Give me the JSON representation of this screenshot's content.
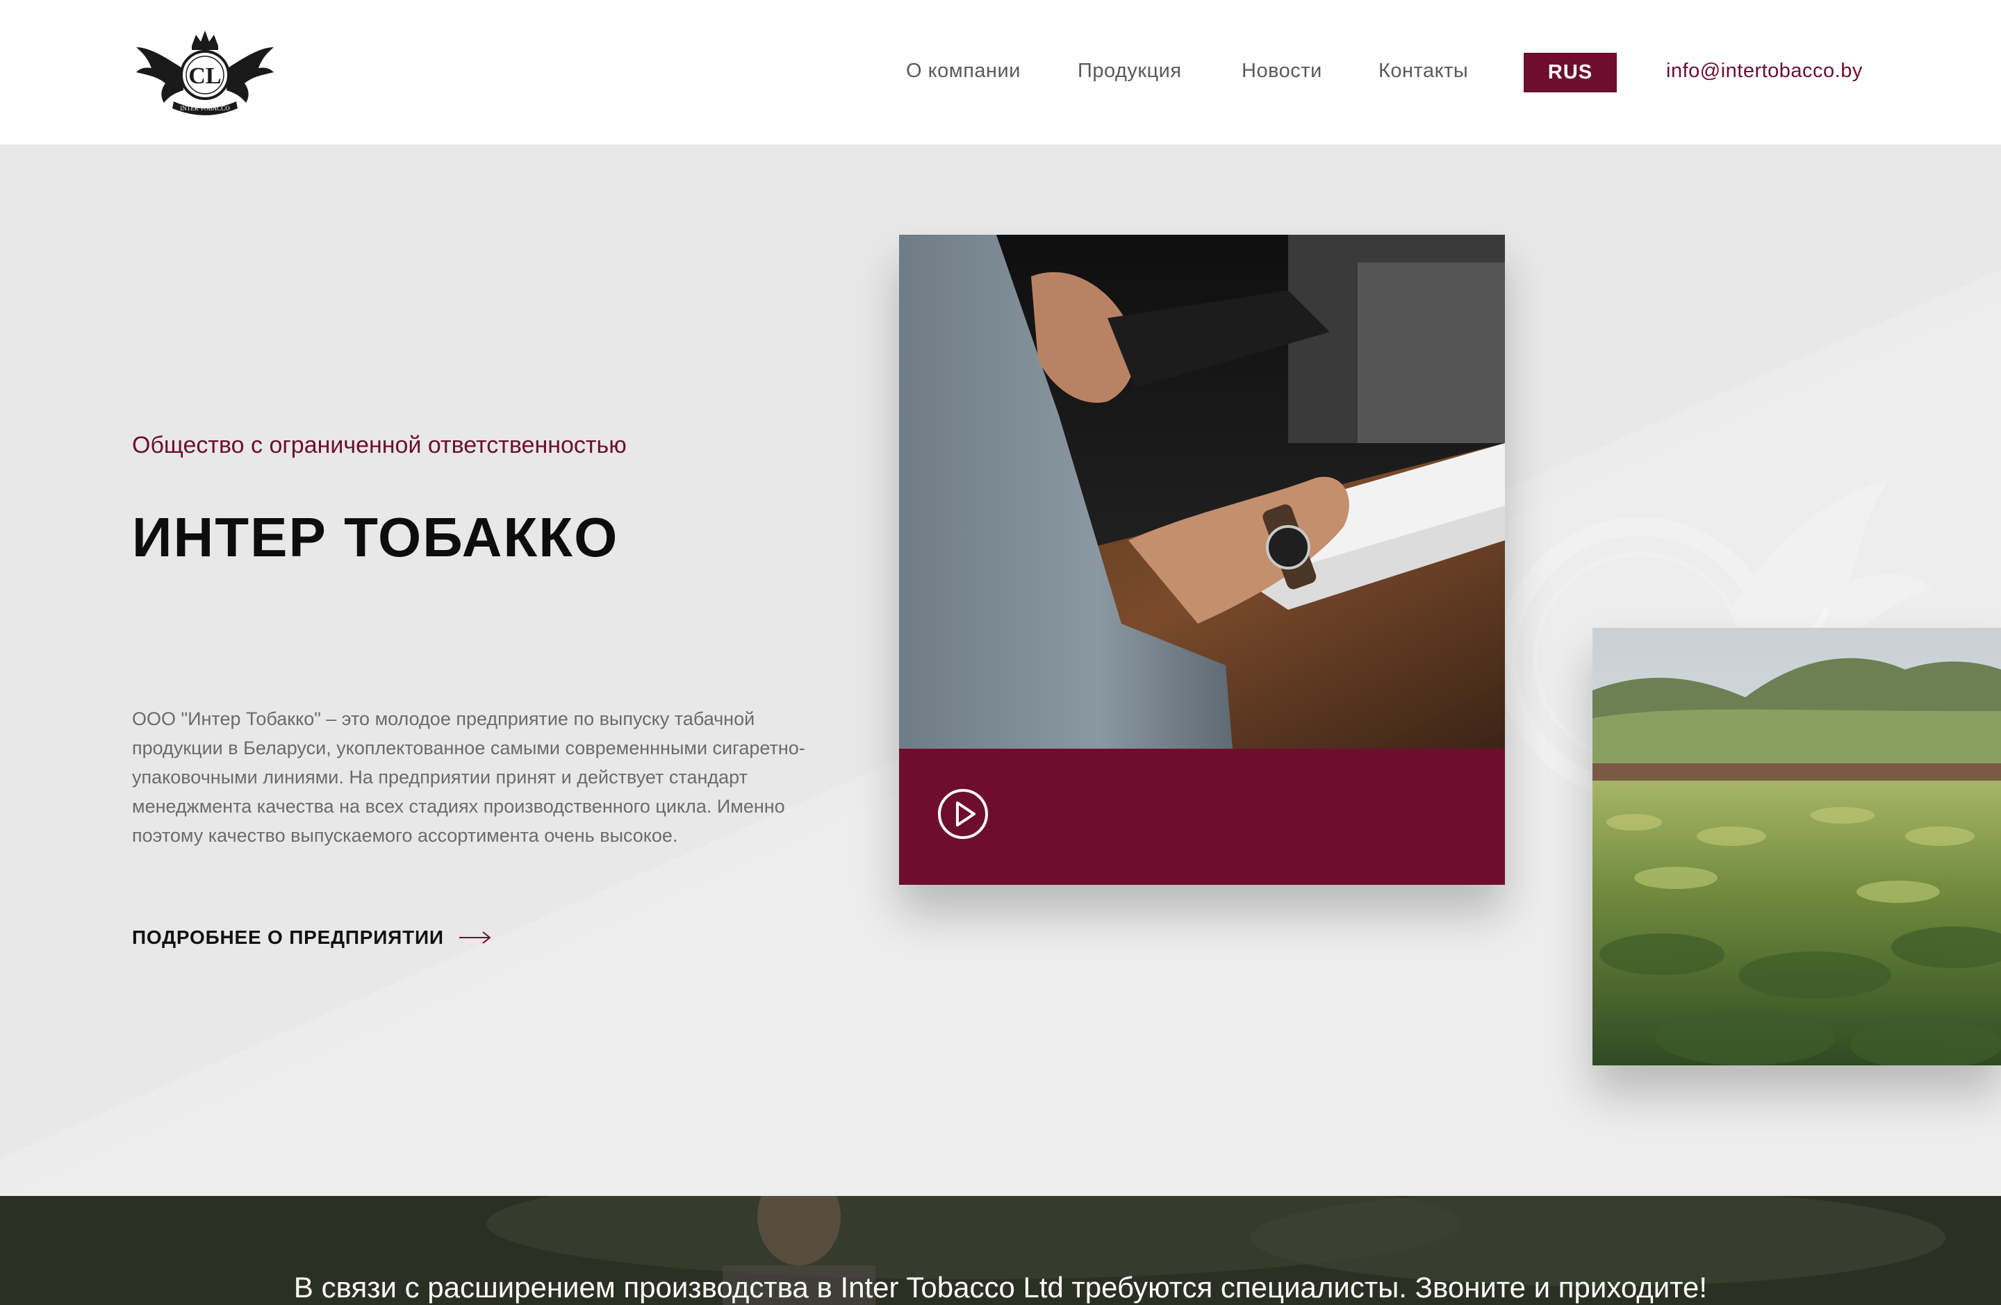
{
  "header": {
    "logo_text": "INTER TOBACCO",
    "nav": [
      {
        "label": "О компании"
      },
      {
        "label": "Продукция"
      },
      {
        "label": "Новости"
      },
      {
        "label": "Контакты"
      }
    ],
    "language": "RUS",
    "email": "info@intertobacco.by"
  },
  "hero": {
    "subtitle": "Общество с ограниченной ответственностью",
    "title": "ИНТЕР ТОБАККО",
    "description": "ООО \"Интер Тобакко\" – это молодое предприятие по выпуску табачной продукции в Беларуси, укоплектованное самыми современнными сигаретно-упаковочными линиями. На предприятии принят и действует стандарт менеджмента качества на всех стадиях производственного цикла. Именно поэтому качество выпускаемого ассортимента очень высокое.",
    "more_link": "ПОДРОБНЕЕ О ПРЕДПРИЯТИИ"
  },
  "icons": {
    "play": "play-icon",
    "arrow": "arrow-right-icon"
  },
  "banner": {
    "text": "В связи с расширением производства в Inter Tobacco Ltd требуются специалисты. Звоните и приходите!"
  },
  "colors": {
    "accent": "#6e0e2f",
    "hero_bg": "#e8e8e9"
  }
}
